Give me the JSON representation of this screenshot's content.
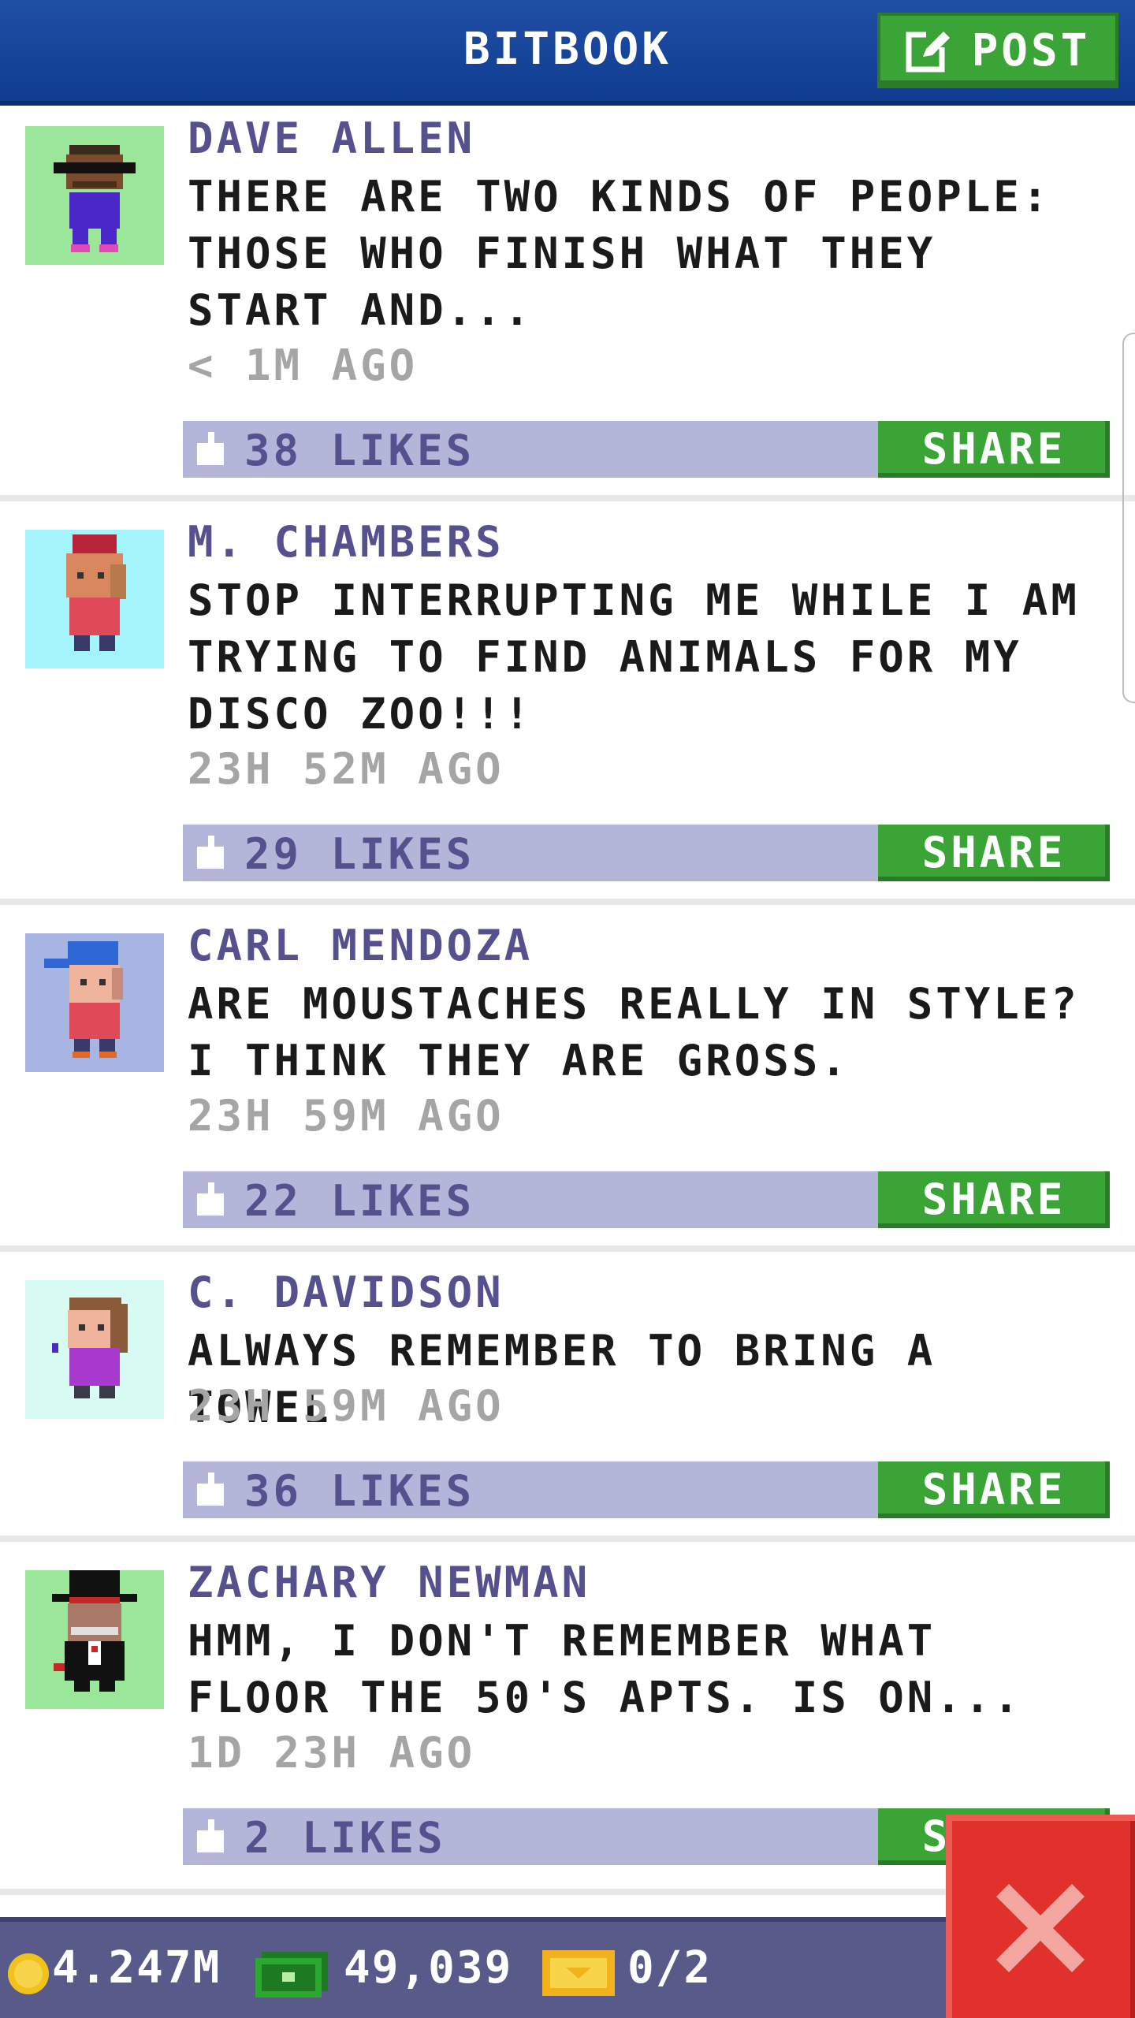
{
  "header": {
    "title": "BITBOOK",
    "post_label": "POST"
  },
  "feed": {
    "share_label": "SHARE",
    "posts": [
      {
        "name": "DAVE ALLEN",
        "message": "THERE ARE TWO KINDS OF PEOPLE: THOSE WHO FINISH WHAT THEY START AND...",
        "time": "< 1M AGO",
        "likes": "38 LIKES",
        "avatar_bg": "#9be79a"
      },
      {
        "name": "M. CHAMBERS",
        "message": "STOP INTERRUPTING ME WHILE I AM TRYING TO FIND ANIMALS FOR MY DISCO ZOO!!!",
        "time": "23H 52M AGO",
        "likes": "29 LIKES",
        "avatar_bg": "#a3f5fb"
      },
      {
        "name": "CARL MENDOZA",
        "message": "ARE MOUSTACHES REALLY IN STYLE? I THINK THEY ARE GROSS.",
        "time": "23H 59M AGO",
        "likes": "22 LIKES",
        "avatar_bg": "#a7b5e3"
      },
      {
        "name": "C. DAVIDSON",
        "message": "ALWAYS REMEMBER TO BRING A TOWEL",
        "time": "23H 59M AGO",
        "likes": "36 LIKES",
        "avatar_bg": "#d8fbf4"
      },
      {
        "name": "ZACHARY NEWMAN",
        "message": "HMM, I DON'T REMEMBER WHAT FLOOR THE 50'S APTS. IS ON...",
        "time": "1D 23H AGO",
        "likes": "2 LIKES",
        "avatar_bg": "#9be79a"
      }
    ]
  },
  "status": {
    "coins": "4.247M",
    "bux": "49,039",
    "tickets": "0/2"
  },
  "colors": {
    "header": "#1f4fa6",
    "share_green": "#3aa436",
    "likes_bar": "#b4b6d9",
    "name_purple": "#55508e",
    "close_red": "#e0312c"
  },
  "icons": [
    "post-edit-icon",
    "thumbs-up-icon",
    "coin-icon",
    "cash-icon",
    "ticket-icon",
    "close-x-icon"
  ]
}
